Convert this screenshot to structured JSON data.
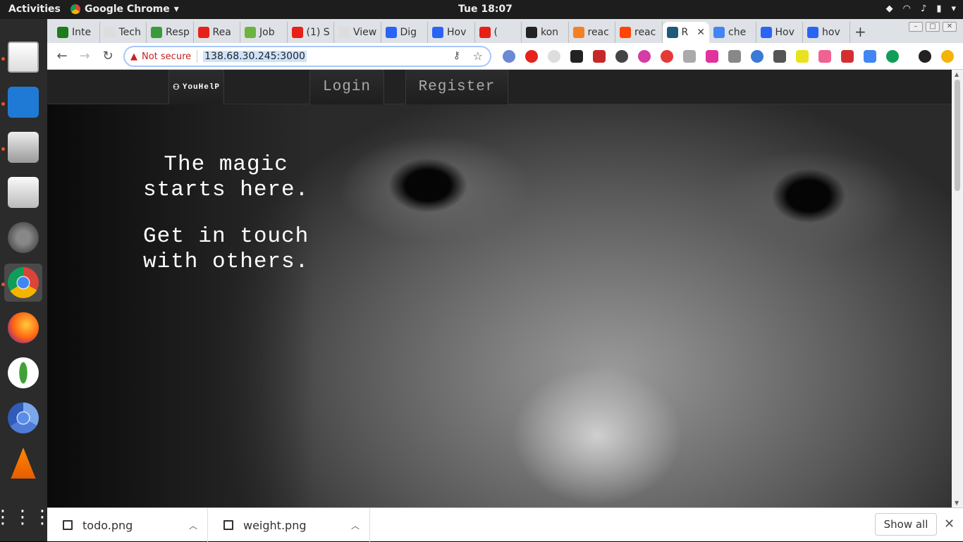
{
  "system": {
    "activities": "Activities",
    "app_name": "Google Chrome",
    "clock": "Tue 18:07"
  },
  "browser": {
    "tabs": [
      {
        "title": "Inte",
        "favicon": "green-terminal-icon",
        "color": "#1b7d1b"
      },
      {
        "title": "Tech",
        "favicon": "page-icon",
        "color": "#dddddd"
      },
      {
        "title": "Resp",
        "favicon": "leaf-icon",
        "color": "#3a9a3a"
      },
      {
        "title": "Rea",
        "favicon": "youtube-icon",
        "color": "#e62117"
      },
      {
        "title": "Job",
        "favicon": "power-icon",
        "color": "#6db33f"
      },
      {
        "title": "(1) S",
        "favicon": "youtube-icon",
        "color": "#e62117"
      },
      {
        "title": "View",
        "favicon": "page-icon",
        "color": "#dddddd"
      },
      {
        "title": "Dig",
        "favicon": "digitalocean-icon",
        "color": "#2a64f5"
      },
      {
        "title": "Hov",
        "favicon": "digitalocean-icon",
        "color": "#2a64f5"
      },
      {
        "title": "(",
        "favicon": "youtube-icon",
        "color": "#e62117"
      },
      {
        "title": "kon",
        "favicon": "github-icon",
        "color": "#222222"
      },
      {
        "title": "reac",
        "favicon": "stackoverflow-icon",
        "color": "#f48024"
      },
      {
        "title": "reac",
        "favicon": "reddit-icon",
        "color": "#ff4500"
      },
      {
        "title": "R",
        "favicon": "react-icon",
        "color": "#1e5a7a"
      },
      {
        "title": "che",
        "favicon": "google-icon",
        "color": "#4285f4"
      },
      {
        "title": "Hov",
        "favicon": "digitalocean-icon",
        "color": "#2a64f5"
      },
      {
        "title": "hov",
        "favicon": "digitalocean-icon",
        "color": "#2a64f5"
      }
    ],
    "omnibox": {
      "security_label": "Not secure",
      "url": "138.68.30.245:3000"
    }
  },
  "site": {
    "brand": "YouHelP",
    "nav": [
      {
        "label": "Login"
      },
      {
        "label": "Register"
      }
    ],
    "hero": {
      "line1": "The magic\nstarts here.",
      "line2": "Get in touch\nwith others."
    }
  },
  "downloads": {
    "items": [
      {
        "name": "todo.png"
      },
      {
        "name": "weight.png"
      }
    ],
    "show_all": "Show all"
  }
}
